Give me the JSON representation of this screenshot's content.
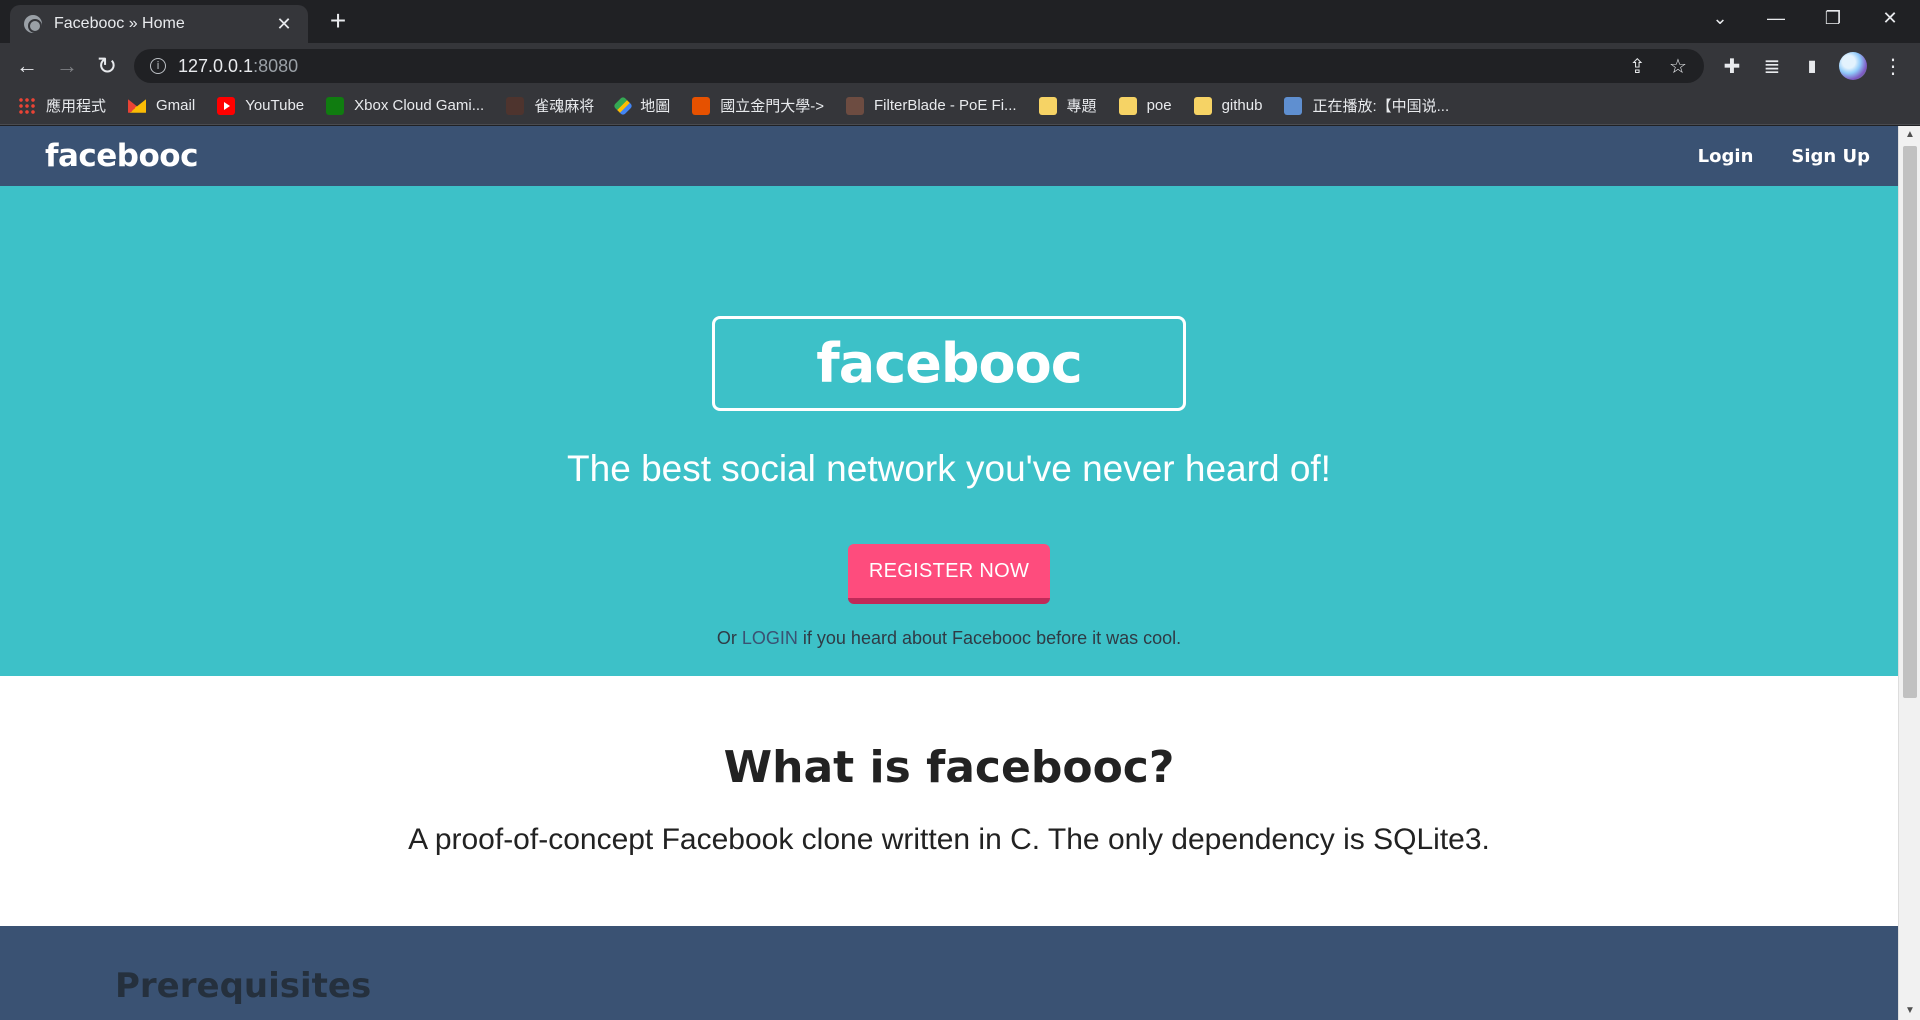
{
  "browser": {
    "tab": {
      "title": "Facebooc » Home",
      "close": "✕"
    },
    "new_tab": "+",
    "window_controls": {
      "tab_search": "⌄",
      "minimize": "—",
      "restore": "❐",
      "close": "✕"
    },
    "nav": {
      "back": "←",
      "forward": "→",
      "reload": "↻"
    },
    "address": {
      "host": "127.0.0.1",
      "port": ":8080"
    },
    "toolbar_icons": {
      "share": "⇪",
      "star": "☆",
      "extensions": "✚",
      "reading_list": "≣",
      "side_panel": "▮",
      "menu": "⋮"
    },
    "bookmarks": [
      {
        "label": "應用程式",
        "icon": "apps-icon"
      },
      {
        "label": "Gmail",
        "icon": "gmail-icon"
      },
      {
        "label": "YouTube",
        "icon": "youtube-icon"
      },
      {
        "label": "Xbox Cloud Gami...",
        "icon": "xbox-icon"
      },
      {
        "label": "雀魂麻将",
        "icon": "mahjong-icon"
      },
      {
        "label": "地圖",
        "icon": "maps-icon"
      },
      {
        "label": "國立金門大學->",
        "icon": "school-icon"
      },
      {
        "label": "FilterBlade - PoE Fi...",
        "icon": "filterblade-icon"
      },
      {
        "label": "專題",
        "icon": "folder-icon"
      },
      {
        "label": "poe",
        "icon": "folder-icon"
      },
      {
        "label": "github",
        "icon": "folder-icon"
      },
      {
        "label": "正在播放:【中国说...",
        "icon": "media-icon"
      }
    ]
  },
  "site": {
    "brand": "facebooc",
    "nav_links": {
      "login": "Login",
      "signup": "Sign Up"
    },
    "hero": {
      "brand": "facebooc",
      "tagline": "The best social network you've never heard of!",
      "register_button": "REGISTER NOW",
      "note_prefix": "Or",
      "note_link": "LOGIN",
      "note_suffix": "if you heard about Facebooc before it was cool."
    },
    "about": {
      "title": "What is facebooc?",
      "text": "A proof-of-concept Facebook clone written in C. The only dependency is SQLite3."
    },
    "prereq": {
      "title": "Prerequisites"
    }
  },
  "scrollbar": {
    "up": "▲",
    "down": "▼"
  }
}
